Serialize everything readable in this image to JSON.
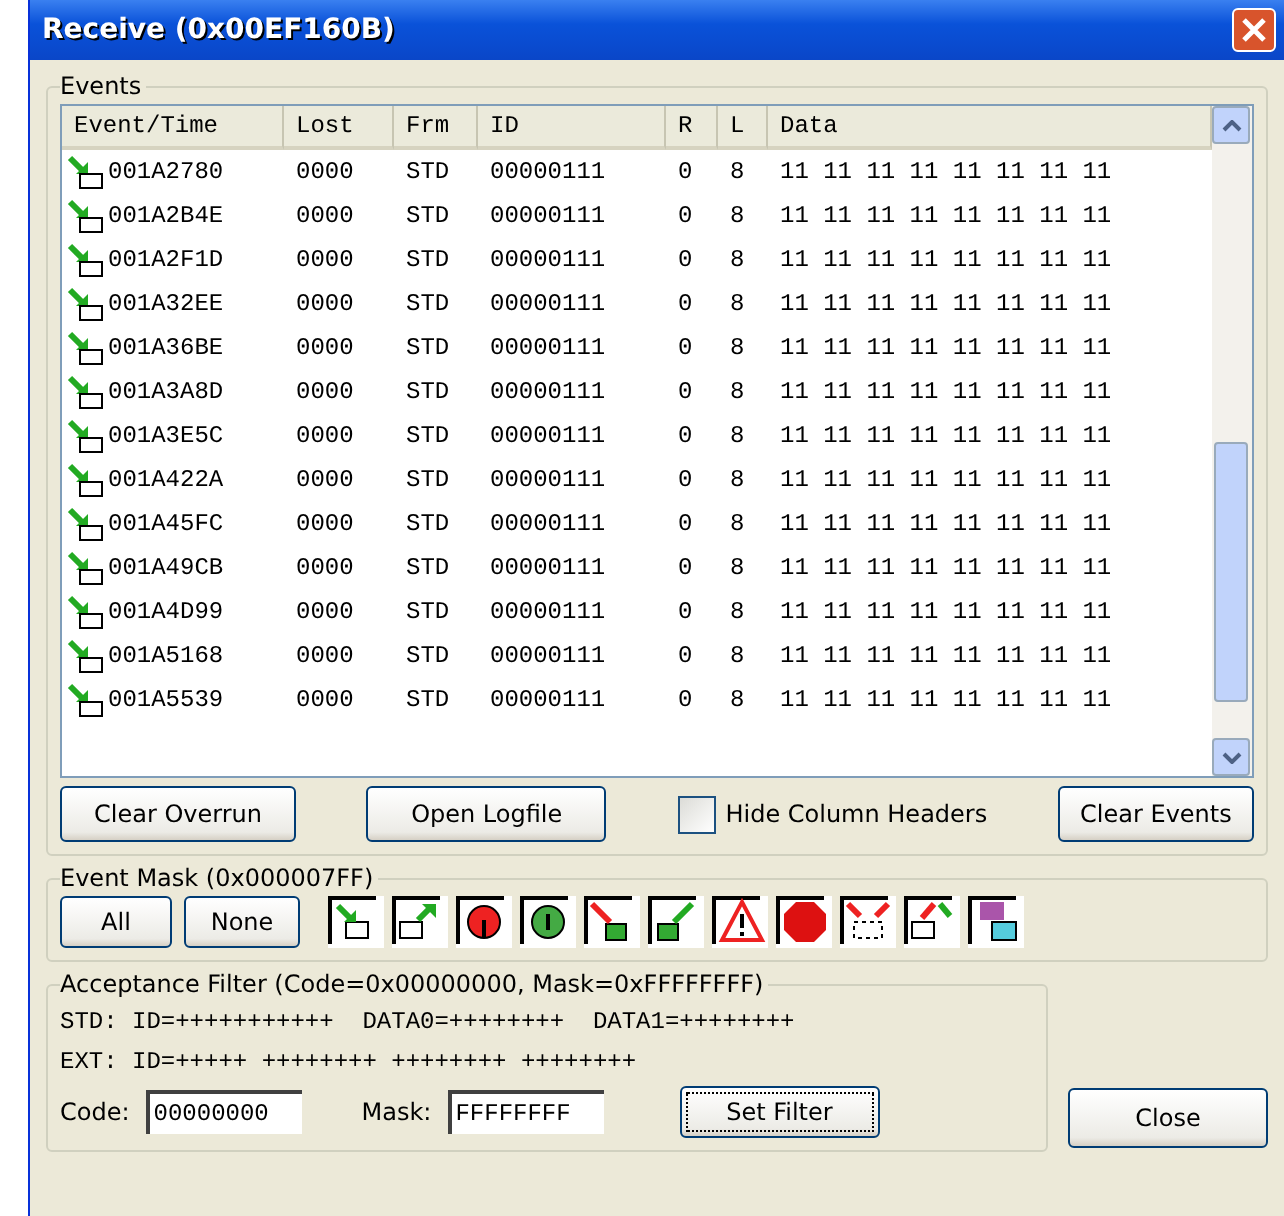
{
  "window": {
    "title": "Receive (0x00EF160B)"
  },
  "events": {
    "legend": "Events",
    "columns": [
      "Event/Time",
      "Lost",
      "Frm",
      "ID",
      "R",
      "L",
      "Data"
    ],
    "rows": [
      [
        "001A2780",
        "0000",
        "STD",
        "00000111",
        "0",
        "8",
        "11 11 11 11 11 11 11 11"
      ],
      [
        "001A2B4E",
        "0000",
        "STD",
        "00000111",
        "0",
        "8",
        "11 11 11 11 11 11 11 11"
      ],
      [
        "001A2F1D",
        "0000",
        "STD",
        "00000111",
        "0",
        "8",
        "11 11 11 11 11 11 11 11"
      ],
      [
        "001A32EE",
        "0000",
        "STD",
        "00000111",
        "0",
        "8",
        "11 11 11 11 11 11 11 11"
      ],
      [
        "001A36BE",
        "0000",
        "STD",
        "00000111",
        "0",
        "8",
        "11 11 11 11 11 11 11 11"
      ],
      [
        "001A3A8D",
        "0000",
        "STD",
        "00000111",
        "0",
        "8",
        "11 11 11 11 11 11 11 11"
      ],
      [
        "001A3E5C",
        "0000",
        "STD",
        "00000111",
        "0",
        "8",
        "11 11 11 11 11 11 11 11"
      ],
      [
        "001A422A",
        "0000",
        "STD",
        "00000111",
        "0",
        "8",
        "11 11 11 11 11 11 11 11"
      ],
      [
        "001A45FC",
        "0000",
        "STD",
        "00000111",
        "0",
        "8",
        "11 11 11 11 11 11 11 11"
      ],
      [
        "001A49CB",
        "0000",
        "STD",
        "00000111",
        "0",
        "8",
        "11 11 11 11 11 11 11 11"
      ],
      [
        "001A4D99",
        "0000",
        "STD",
        "00000111",
        "0",
        "8",
        "11 11 11 11 11 11 11 11"
      ],
      [
        "001A5168",
        "0000",
        "STD",
        "00000111",
        "0",
        "8",
        "11 11 11 11 11 11 11 11"
      ],
      [
        "001A5539",
        "0000",
        "STD",
        "00000111",
        "0",
        "8",
        "11 11 11 11 11 11 11 11"
      ]
    ],
    "clear_overrun": "Clear Overrun",
    "open_logfile": "Open Logfile",
    "hide_headers": {
      "label": "Hide Column Headers",
      "checked": false
    },
    "clear_events": "Clear Events"
  },
  "event_mask": {
    "legend": "Event Mask (0x000007FF)",
    "all": "All",
    "none": "None"
  },
  "acceptance_filter": {
    "legend": "Acceptance Filter (Code=0x00000000, Mask=0xFFFFFFFF)",
    "std_line": "STD: ID=+++++++++++  DATA0=++++++++  DATA1=++++++++",
    "ext_line": "EXT: ID=+++++ ++++++++ ++++++++ ++++++++",
    "code_label": "Code:",
    "code_value": "00000000",
    "mask_label": "Mask:",
    "mask_value": "FFFFFFFF",
    "set_filter": "Set Filter"
  },
  "close": "Close"
}
